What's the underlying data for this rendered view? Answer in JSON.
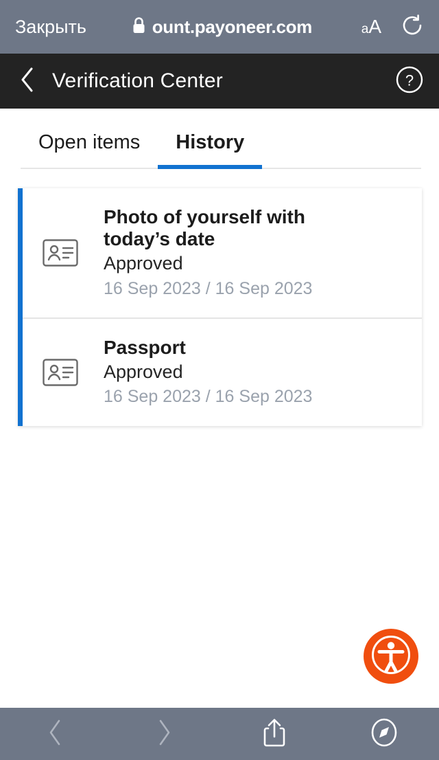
{
  "browser": {
    "close_label": "Закрыть",
    "lock_icon": "lock-icon",
    "url": "ount.payoneer.com",
    "text_size_small": "a",
    "text_size_large": "A",
    "reload_icon": "reload-icon",
    "bar_color": "#6e7787"
  },
  "app_header": {
    "back_icon": "chevron-left-icon",
    "title": "Verification Center",
    "help_icon": "question-mark-circle-icon",
    "background": "#232323"
  },
  "tabs": {
    "accent_color": "#1172d0",
    "items": [
      {
        "label": "Open items",
        "active": false
      },
      {
        "label": "History",
        "active": true
      }
    ]
  },
  "documents": {
    "accent_bar_color": "#1172d0",
    "items": [
      {
        "icon": "id-card-icon",
        "title": "Photo of yourself with today’s date",
        "status": "Approved",
        "dates": "16 Sep 2023 / 16 Sep 2023"
      },
      {
        "icon": "id-card-icon",
        "title": "Passport",
        "status": "Approved",
        "dates": "16 Sep 2023 / 16 Sep 2023"
      }
    ]
  },
  "accessibility_button": {
    "icon": "accessibility-person-icon",
    "color": "#f04e0f"
  },
  "bottom_toolbar": {
    "background": "#6e7787",
    "back_icon": "chevron-left-icon",
    "forward_icon": "chevron-right-icon",
    "share_icon": "share-icon",
    "tabs_icon": "safari-compass-icon"
  }
}
